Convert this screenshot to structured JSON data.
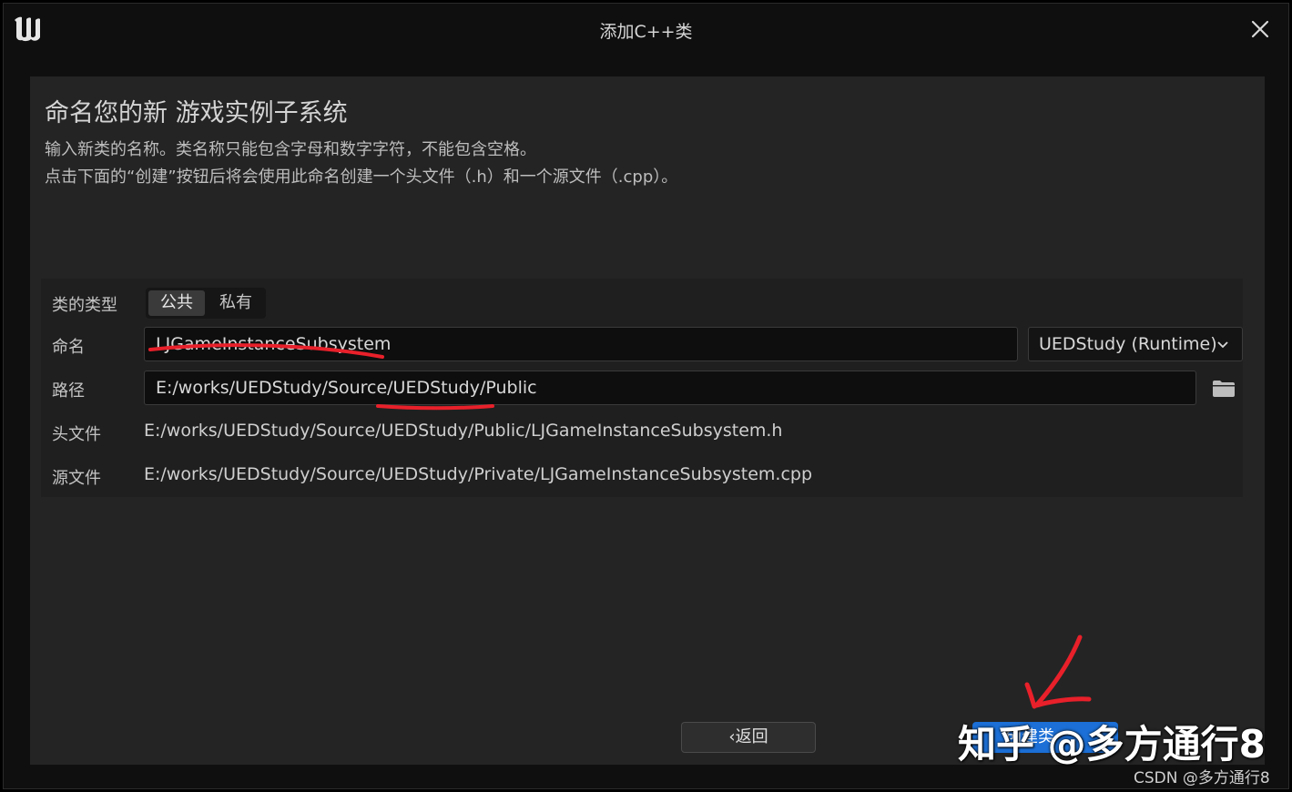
{
  "window": {
    "title": "添加C++类",
    "logo_icon": "unreal-engine-logo",
    "close_icon": "close-icon"
  },
  "heading": "命名您的新 游戏实例子系统",
  "description": {
    "line1": "输入新类的名称。类名称只能包含字母和数字字符，不能包含空格。",
    "line2": "点击下面的“创建”按钮后将会使用此命名创建一个头文件（.h）和一个源文件（.cpp）。"
  },
  "form": {
    "class_type_label": "类的类型",
    "class_type_options": [
      "公共",
      "私有"
    ],
    "class_type_selected": "公共",
    "name_label": "命名",
    "name_value": "LJGameInstanceSubsystem",
    "module_value": "UEDStudy (Runtime)",
    "path_label": "路径",
    "path_value": "E:/works/UEDStudy/Source/UEDStudy/Public",
    "header_label": "头文件",
    "header_value": "E:/works/UEDStudy/Source/UEDStudy/Public/LJGameInstanceSubsystem.h",
    "source_label": "源文件",
    "source_value": "E:/works/UEDStudy/Source/UEDStudy/Private/LJGameInstanceSubsystem.cpp"
  },
  "buttons": {
    "back_label": "返回",
    "create_label": "创建类"
  },
  "watermarks": {
    "zhihu": "知乎 @多方通行8",
    "csdn": "CSDN @多方通行8"
  },
  "colors": {
    "accent": "#1b6fd6",
    "annotation": "#e8202a"
  }
}
